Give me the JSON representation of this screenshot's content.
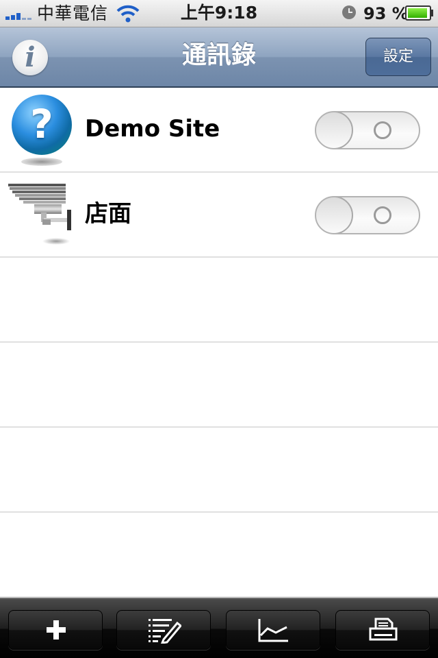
{
  "status_bar": {
    "carrier": "中華電信",
    "time": "上午9:18",
    "battery_percent": "93 %",
    "battery_level": 0.93,
    "signal_bars": 3,
    "icons": [
      "signal-icon",
      "wifi-icon",
      "alarm-icon",
      "battery-icon"
    ]
  },
  "nav_bar": {
    "title": "通訊錄",
    "info_glyph": "i",
    "settings_label": "設定"
  },
  "rows": [
    {
      "label": "Demo Site",
      "icon": "help-icon",
      "icon_glyph": "?",
      "switch_on": false
    },
    {
      "label": "店面",
      "icon": "security-camera-icon",
      "switch_on": false
    }
  ],
  "empty_row_count": 4,
  "toolbar": {
    "buttons": [
      "add-icon",
      "edit-list-icon",
      "chart-icon",
      "print-icon"
    ]
  },
  "colors": {
    "nav_bar": "#8ea4c0",
    "settings_button": "#4e6e9a",
    "battery": "#32b000",
    "signal": "#1f5fc8"
  }
}
